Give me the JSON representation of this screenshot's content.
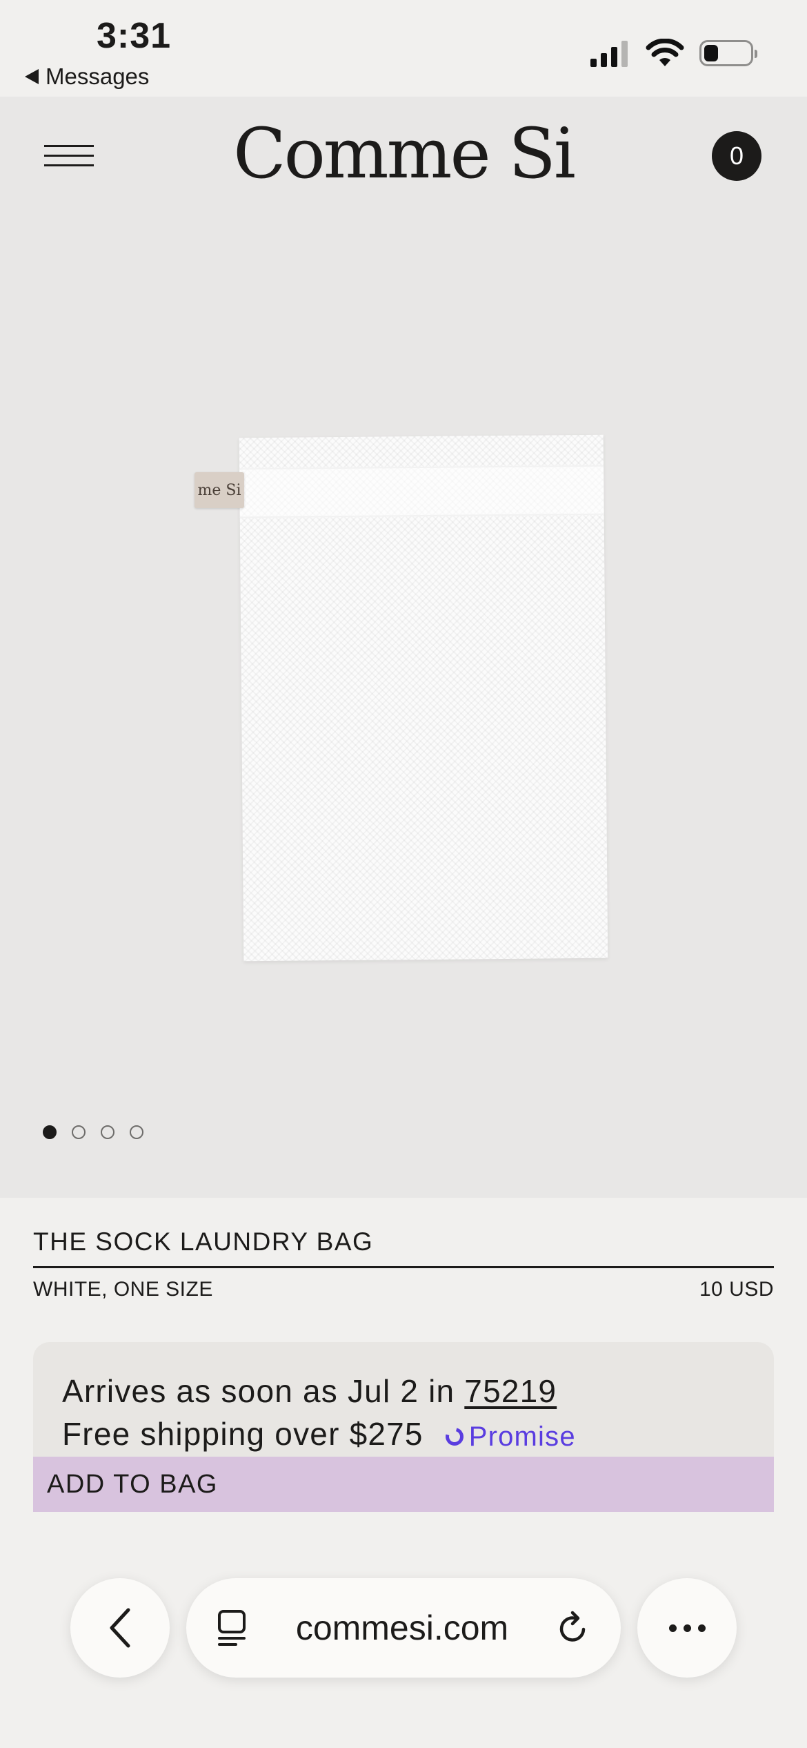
{
  "status_bar": {
    "time": "3:31",
    "back_label": "Messages",
    "icons": [
      "cellular-signal-icon",
      "wifi-icon",
      "battery-icon"
    ]
  },
  "header": {
    "logo": "Comme Si",
    "cart_count": "0",
    "menu_icon": "hamburger-menu-icon"
  },
  "gallery": {
    "tag_text": "me Si",
    "slide_count": 4,
    "active_slide": 1
  },
  "product": {
    "title": "THE SOCK LAUNDRY BAG",
    "variant": "WHITE, ONE SIZE",
    "price": "10 USD"
  },
  "shipping": {
    "arrives_prefix": "Arrives as soon as Jul 2 in",
    "zip": "75219",
    "free_shipping": "Free shipping over $275",
    "promise_label": "Promise",
    "promise_color": "#5a3de0"
  },
  "actions": {
    "add_to_bag": "ADD TO BAG",
    "add_to_bag_color": "#d8c3de"
  },
  "browser": {
    "url": "commesi.com",
    "icons": [
      "back-chevron-icon",
      "tabs-icon",
      "reload-icon",
      "more-options-icon"
    ]
  }
}
